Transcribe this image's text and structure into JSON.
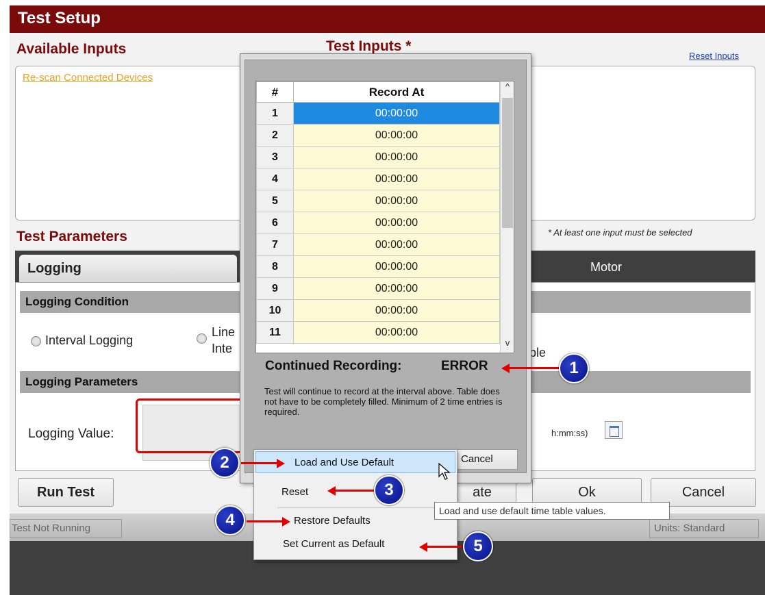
{
  "window": {
    "title": "Test Setup",
    "available_inputs_header": "Available Inputs",
    "test_inputs_header": "Test Inputs *",
    "reset_inputs_link": "Reset Inputs",
    "rescan_link": "Re-scan Connected Devices",
    "at_least_note": "* At least one input must be selected",
    "test_parameters_header": "Test Parameters"
  },
  "tabs": {
    "logging": "Logging",
    "motor": "Motor"
  },
  "logging": {
    "condition_header": "Logging Condition",
    "interval_option": "Interval Logging",
    "linear_option_line1": "Line",
    "linear_option_line2": "Inte",
    "table_option_tail": "ble",
    "parameters_header": "Logging Parameters",
    "logging_value_label": "Logging Value:",
    "time_format_hint": "h:mm:ss)"
  },
  "buttons": {
    "run_test": "Run Test",
    "update": "ate",
    "ok": "Ok",
    "cancel": "Cancel"
  },
  "status": {
    "left": "Test Not Running",
    "right": "Units:  Standard"
  },
  "popup": {
    "columns": [
      "#",
      "Record At"
    ],
    "rows": [
      {
        "num": "1",
        "time": "00:00:00"
      },
      {
        "num": "2",
        "time": "00:00:00"
      },
      {
        "num": "3",
        "time": "00:00:00"
      },
      {
        "num": "4",
        "time": "00:00:00"
      },
      {
        "num": "5",
        "time": "00:00:00"
      },
      {
        "num": "6",
        "time": "00:00:00"
      },
      {
        "num": "7",
        "time": "00:00:00"
      },
      {
        "num": "8",
        "time": "00:00:00"
      },
      {
        "num": "9",
        "time": "00:00:00"
      },
      {
        "num": "10",
        "time": "00:00:00"
      },
      {
        "num": "11",
        "time": "00:00:00"
      }
    ],
    "selected_row": 1,
    "continued_recording_label": "Continued Recording:",
    "continued_recording_value": "ERROR",
    "help_text": "Test will continue to record at the interval above.  Table does not have to be completely filled.  Minimum of 2 time entries is required.",
    "cancel_label": "Cancel",
    "scroll_up_icon": "^",
    "scroll_down_icon": "v"
  },
  "context_menu": {
    "load_default": "Load and Use Default",
    "reset": "Reset",
    "restore_defaults": "Restore Defaults",
    "set_current_default": "Set Current as Default"
  },
  "tooltip": "Load and use default time table values.",
  "callouts": [
    "1",
    "2",
    "3",
    "4",
    "5"
  ],
  "colors": {
    "title_bar": "#7b0b0b",
    "callout_blue": "#07118a",
    "arrow_red": "#e00000",
    "selected_row": "#1e8be0",
    "cell_fill": "#fdfad6"
  }
}
